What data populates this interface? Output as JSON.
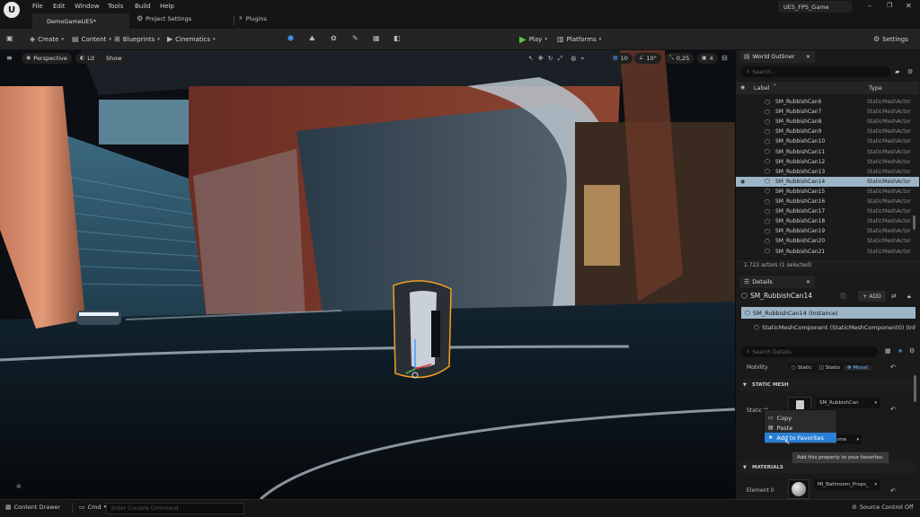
{
  "menu": {
    "file": "File",
    "edit": "Edit",
    "window": "Window",
    "tools": "Tools",
    "build": "Build",
    "help": "Help"
  },
  "project_name": "UE5_FPS_Game",
  "tabs": {
    "level": "DemoGameUE5*",
    "project_settings": "Project Settings",
    "plugins": "Plugins"
  },
  "toolbar": {
    "create": "Create",
    "content": "Content",
    "blueprints": "Blueprints",
    "cinematics": "Cinematics",
    "play": "Play",
    "platforms": "Platforms",
    "settings": "Settings"
  },
  "viewport": {
    "perspective": "Perspective",
    "lit": "Lit",
    "show": "Show",
    "grid_snap": "10",
    "rot_snap": "10°",
    "scale_snap": "0,25",
    "cam_speed": "4"
  },
  "outliner": {
    "tab": "World Outliner",
    "search_placeholder": "Search...",
    "col_label": "Label",
    "col_type": "Type",
    "rows": [
      {
        "label": "SM_RubbishCan6",
        "type": "StaticMeshActor"
      },
      {
        "label": "SM_RubbishCan7",
        "type": "StaticMeshActor"
      },
      {
        "label": "SM_RubbishCan8",
        "type": "StaticMeshActor"
      },
      {
        "label": "SM_RubbishCan9",
        "type": "StaticMeshActor"
      },
      {
        "label": "SM_RubbishCan10",
        "type": "StaticMeshActor"
      },
      {
        "label": "SM_RubbishCan11",
        "type": "StaticMeshActor"
      },
      {
        "label": "SM_RubbishCan12",
        "type": "StaticMeshActor"
      },
      {
        "label": "SM_RubbishCan13",
        "type": "StaticMeshActor"
      },
      {
        "label": "SM_RubbishCan14",
        "type": "StaticMeshActor",
        "selected": true
      },
      {
        "label": "SM_RubbishCan15",
        "type": "StaticMeshActor"
      },
      {
        "label": "SM_RubbishCan16",
        "type": "StaticMeshActor"
      },
      {
        "label": "SM_RubbishCan17",
        "type": "StaticMeshActor"
      },
      {
        "label": "SM_RubbishCan18",
        "type": "StaticMeshActor"
      },
      {
        "label": "SM_RubbishCan19",
        "type": "StaticMeshActor"
      },
      {
        "label": "SM_RubbishCan20",
        "type": "StaticMeshActor"
      },
      {
        "label": "SM_RubbishCan21",
        "type": "StaticMeshActor"
      }
    ],
    "status": "1.722 actors (1 selected)"
  },
  "details": {
    "tab": "Details",
    "actor_name": "SM_RubbishCan14",
    "add_label": "ADD",
    "instance": "SM_RubbishCan14 (Instance)",
    "component": "StaticMeshComponent (StaticMeshComponent0) (Inher",
    "search_placeholder": "Search Details",
    "mobility_label": "Mobility",
    "mobility_static": "Static",
    "mobility_stationary": "Statio",
    "mobility_movable": "Moval",
    "section_static_mesh": "STATIC MESH",
    "static_mesh_label": "Static M",
    "static_mesh_value": "SM_RubbishCan",
    "dropdown2_value": "ame",
    "section_materials": "MATERIALS",
    "element0_label": "Element 0",
    "element0_value": "MI_Bathroom_Props_"
  },
  "context_menu": {
    "copy": "Copy",
    "paste": "Paste",
    "add_fav": "Add to Favorites",
    "tooltip": "Add this property to your favorites."
  },
  "bottom": {
    "content_drawer": "Content Drawer",
    "cmd": "Cmd",
    "console_placeholder": "Enter Console Command",
    "source_control": "Source Control Off"
  },
  "colors": {
    "selection": "#9cb5c7",
    "accent_blue": "#2b7fd6",
    "play_green": "#62c24a"
  }
}
